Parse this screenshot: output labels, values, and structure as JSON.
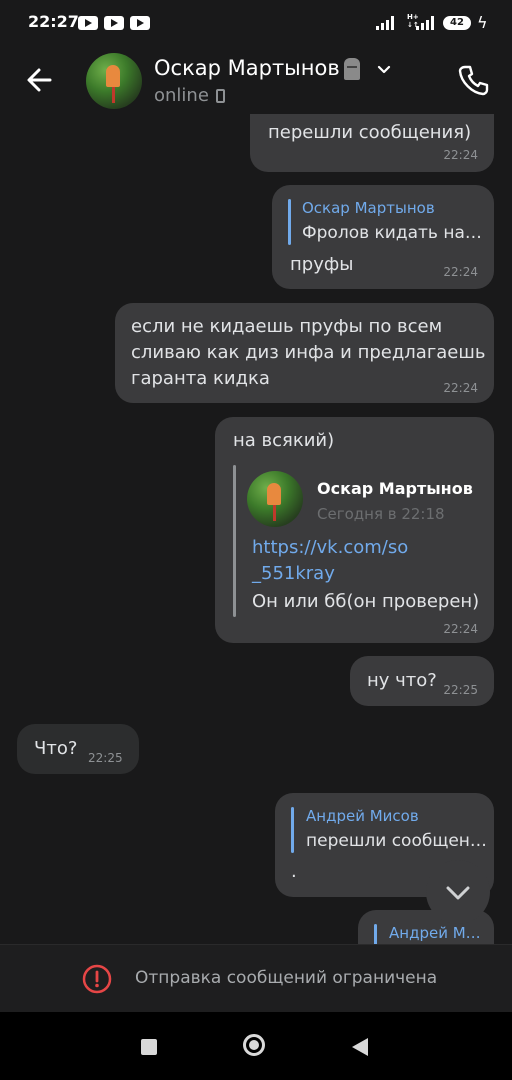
{
  "status_bar": {
    "time": "22:27",
    "battery": "42"
  },
  "header": {
    "contact_name": "Оскар Мартынов",
    "status": "online"
  },
  "messages": [
    {
      "text": "перешли сообщения)",
      "time": "22:24"
    },
    {
      "quote_author": "Оскар Мартынов",
      "quote_text": "Фролов кидать на…",
      "text": "пруфы",
      "time": "22:24"
    },
    {
      "lines": [
        "если не кидаешь пруфы по всем",
        "сливаю как диз инфа и предлагаешь",
        "гаранта кидка"
      ],
      "time": "22:24"
    },
    {
      "text": "на всякий)",
      "forward_author": "Оскар Мартынов",
      "forward_date": "Сегодня в 22:18",
      "link_lines": [
        "https://vk.com/so",
        "_551kray"
      ],
      "forward_text": "Он или бб(он проверен)",
      "time": "22:24"
    },
    {
      "text": "ну что?",
      "time": "22:25"
    },
    {
      "text": "Что?",
      "time": "22:25"
    },
    {
      "quote_author": "Андрей Мисов",
      "quote_text": "перешли сообщен…",
      "text": ".",
      "time": ""
    },
    {
      "quote_author": "Андрей М…"
    }
  ],
  "restriction": {
    "text": "Отправка сообщений ограничена"
  },
  "colors": {
    "background": "#19191a",
    "bubble_out": "#3b3b3d",
    "bubble_in": "#2c2d2e",
    "accent": "#71aaeb",
    "warning": "#e64646"
  },
  "icons": [
    "back-arrow-icon",
    "chevron-down-icon",
    "phone-icon",
    "warning-icon",
    "scroll-down-icon",
    "recents-icon",
    "home-icon",
    "nav-back-icon"
  ]
}
